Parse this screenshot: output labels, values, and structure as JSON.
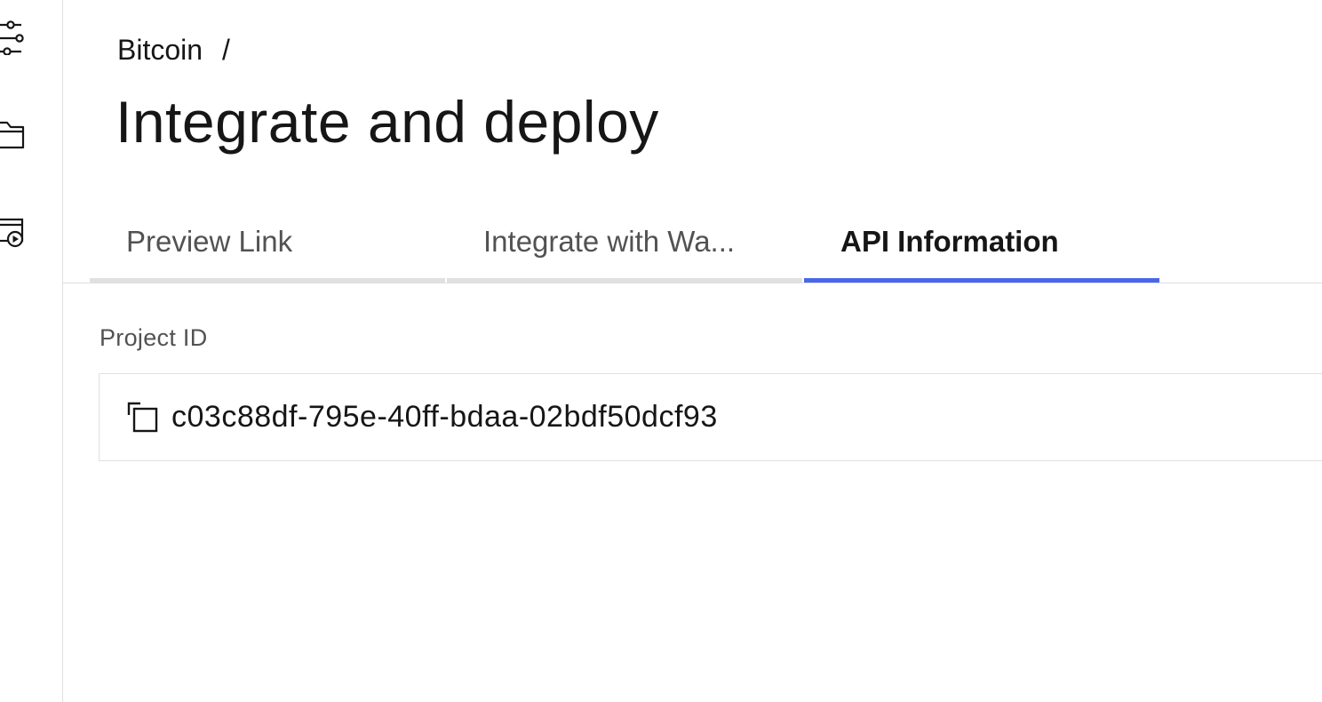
{
  "sidebar": {
    "items": [
      {
        "icon": "settings-sliders-icon"
      },
      {
        "icon": "folder-icon"
      },
      {
        "icon": "deploy-icon"
      }
    ]
  },
  "breadcrumb": {
    "project": "Bitcoin",
    "separator": "/"
  },
  "page": {
    "title": "Integrate and deploy"
  },
  "tabs": [
    {
      "label": "Preview Link",
      "active": false
    },
    {
      "label": "Integrate with Wa...",
      "active": false
    },
    {
      "label": "API Information",
      "active": true
    }
  ],
  "api_info": {
    "project_id_label": "Project ID",
    "project_id_value": "c03c88df-795e-40ff-bdaa-02bdf50dcf93",
    "copy_icon": "copy-icon"
  },
  "colors": {
    "accent": "#4a66e8",
    "text_primary": "#161616",
    "text_secondary": "#525252",
    "border": "#e0e0e0"
  }
}
